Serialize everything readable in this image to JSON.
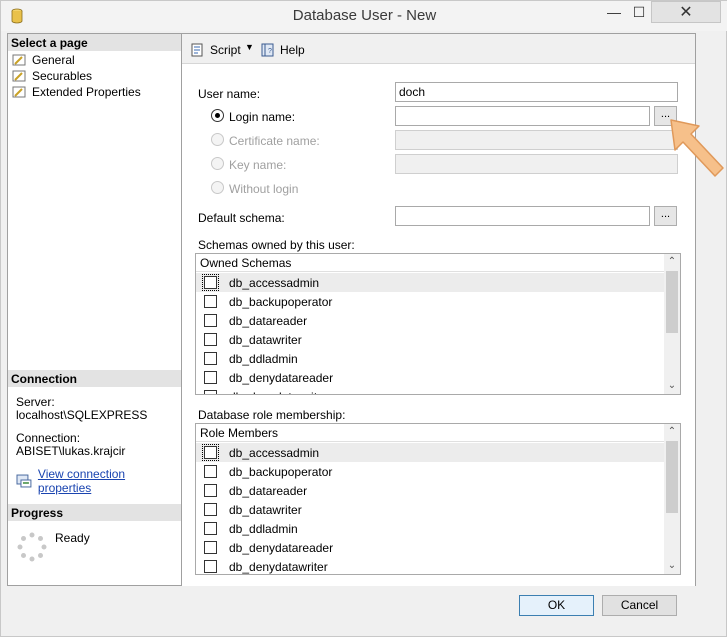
{
  "window": {
    "title": "Database User - New",
    "min_glyph": "—",
    "max_glyph": "☐",
    "close_glyph": "✕"
  },
  "left": {
    "select_page_header": "Select a page",
    "pages": [
      "General",
      "Securables",
      "Extended Properties"
    ],
    "connection_header": "Connection",
    "server_label": "Server:",
    "server_value": "localhost\\SQLEXPRESS",
    "connection_label": "Connection:",
    "connection_value": "ABISET\\lukas.krajcir",
    "view_props_link": "View connection properties",
    "progress_header": "Progress",
    "progress_status": "Ready"
  },
  "toolbar": {
    "script_label": "Script",
    "script_dropdown": "▼",
    "help_label": "Help"
  },
  "form": {
    "user_name_label": "User name:",
    "user_name_value": "doch",
    "login_name_label": "Login name:",
    "login_name_value": "",
    "certificate_name_label": "Certificate name:",
    "key_name_label": "Key name:",
    "without_login_label": "Without login",
    "default_schema_label": "Default schema:",
    "default_schema_value": "",
    "browse_label": "...",
    "selected_user_type": "Login name"
  },
  "schemas": {
    "caption": "Schemas owned by this user:",
    "column_header": "Owned Schemas",
    "rows": [
      "db_accessadmin",
      "db_backupoperator",
      "db_datareader",
      "db_datawriter",
      "db_ddladmin",
      "db_denydatareader",
      "db_denydatawriter"
    ]
  },
  "roles": {
    "caption": "Database role membership:",
    "column_header": "Role Members",
    "rows": [
      "db_accessadmin",
      "db_backupoperator",
      "db_datareader",
      "db_datawriter",
      "db_ddladmin",
      "db_denydatareader",
      "db_denydatawriter"
    ]
  },
  "scroll": {
    "up": "⌃",
    "down": "⌄"
  },
  "buttons": {
    "ok": "OK",
    "cancel": "Cancel"
  },
  "colors": {
    "accent_link": "#1a44b0",
    "callout_arrow": "#f6c08a"
  }
}
